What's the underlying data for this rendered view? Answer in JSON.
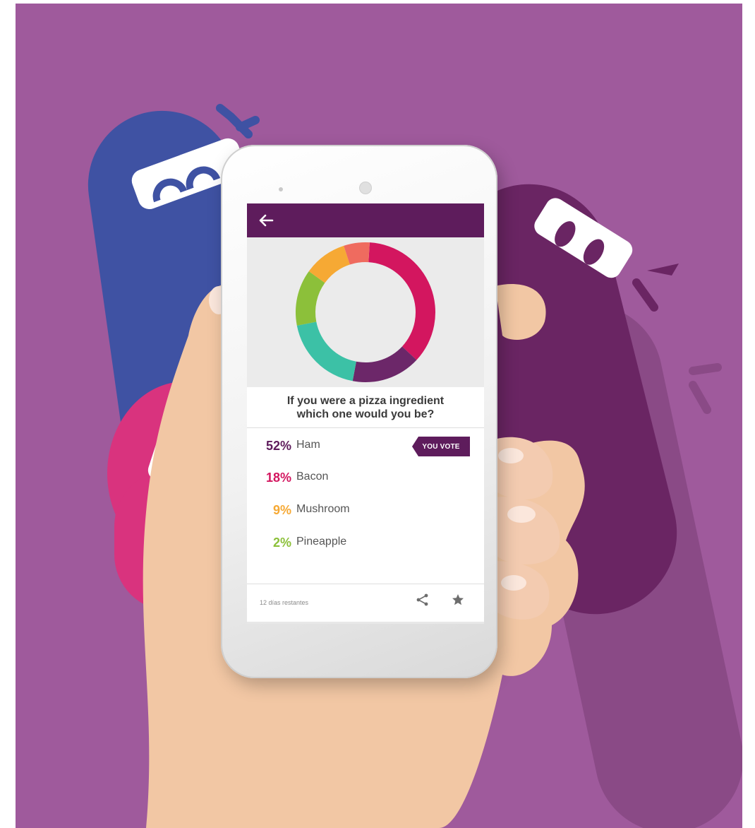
{
  "colors": {
    "background": "#9f5a9c",
    "appbar": "#5e1c5c",
    "ham": "#5e1c5c",
    "bacon": "#d3165f",
    "mushroom": "#f6a934",
    "pineapple": "#8cc03a",
    "teal": "#3cc1a6",
    "coral": "#ef6b5f",
    "ninja_blue": "#3f52a3",
    "ninja_pink": "#d9337e",
    "ninja_purple": "#6a2563"
  },
  "appbar": {
    "back_icon": "arrow-left-icon"
  },
  "chart_data": {
    "type": "pie",
    "donut": true,
    "slices": [
      {
        "color": "#d3165f",
        "value": 36
      },
      {
        "color": "#6c2769",
        "value": 16
      },
      {
        "color": "#3cc1a6",
        "value": 19
      },
      {
        "color": "#8cc03a",
        "value": 13
      },
      {
        "color": "#f6a934",
        "value": 10
      },
      {
        "color": "#ef6b5f",
        "value": 6
      }
    ]
  },
  "poll": {
    "question_line1": "If you were a pizza ingredient",
    "question_line2": "which one would you be?",
    "options": [
      {
        "percent": "52%",
        "label": "Ham",
        "color": "#5e1c5c"
      },
      {
        "percent": "18%",
        "label": "Bacon",
        "color": "#d3165f"
      },
      {
        "percent": "9%",
        "label": "Mushroom",
        "color": "#f6a934"
      },
      {
        "percent": "2%",
        "label": "Pineapple",
        "color": "#8cc03a"
      }
    ],
    "vote_badge": "YOU VOTE"
  },
  "footer": {
    "remaining": "12 días restantes",
    "share_icon": "share-icon",
    "star_icon": "star-icon"
  }
}
